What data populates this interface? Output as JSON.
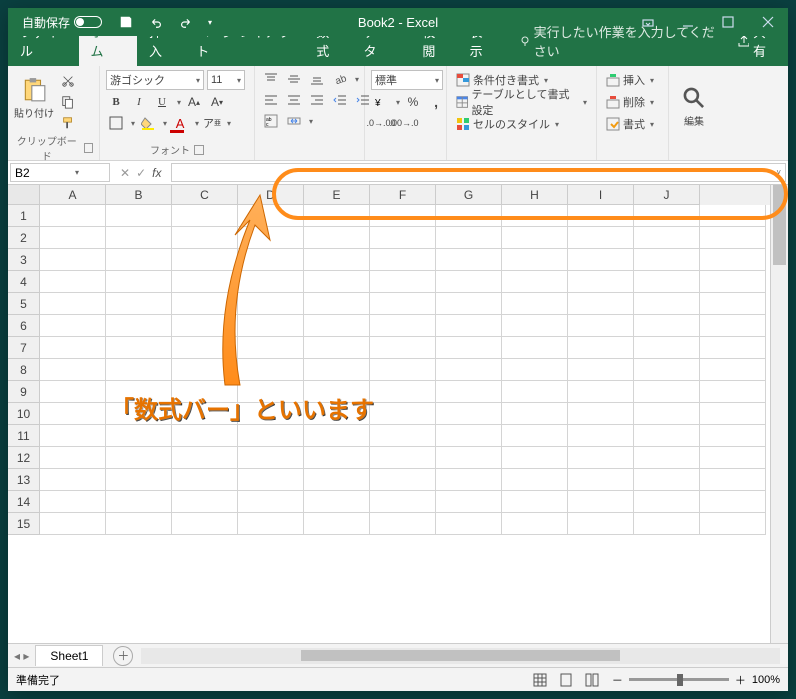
{
  "title": "Book2 - Excel",
  "autosave_label": "自動保存",
  "tabs": {
    "file": "ファイル",
    "home": "ホーム",
    "insert": "挿入",
    "pagelayout": "ページ レイアウト",
    "formulas": "数式",
    "data": "データ",
    "review": "校閲",
    "view": "表示",
    "tell": "実行したい作業を入力してください",
    "share": "共有"
  },
  "ribbon": {
    "clipboard": {
      "paste": "貼り付け",
      "label": "クリップボード"
    },
    "font": {
      "family": "游ゴシック",
      "size": "11",
      "bold": "B",
      "italic": "I",
      "underline": "U",
      "label": "フォント"
    },
    "alignment": {
      "wrap": "ab"
    },
    "number": {
      "format": "標準"
    },
    "styles": {
      "conditional": "条件付き書式",
      "table": "テーブルとして書式設定",
      "cell": "セルのスタイル"
    },
    "cells": {
      "insert": "挿入",
      "delete": "削除",
      "format": "書式"
    },
    "editing": {
      "label": "編集"
    }
  },
  "namebox": "B2",
  "fx_label": "fx",
  "columns": [
    "A",
    "B",
    "C",
    "D",
    "E",
    "F",
    "G",
    "H",
    "I",
    "J"
  ],
  "rows": [
    "1",
    "2",
    "3",
    "4",
    "5",
    "6",
    "7",
    "8",
    "9",
    "10",
    "11",
    "12",
    "13",
    "14",
    "15"
  ],
  "sheet_tab": "Sheet1",
  "status": {
    "ready": "準備完了",
    "zoom": "100%"
  },
  "annotation": "「数式バー」といいます"
}
